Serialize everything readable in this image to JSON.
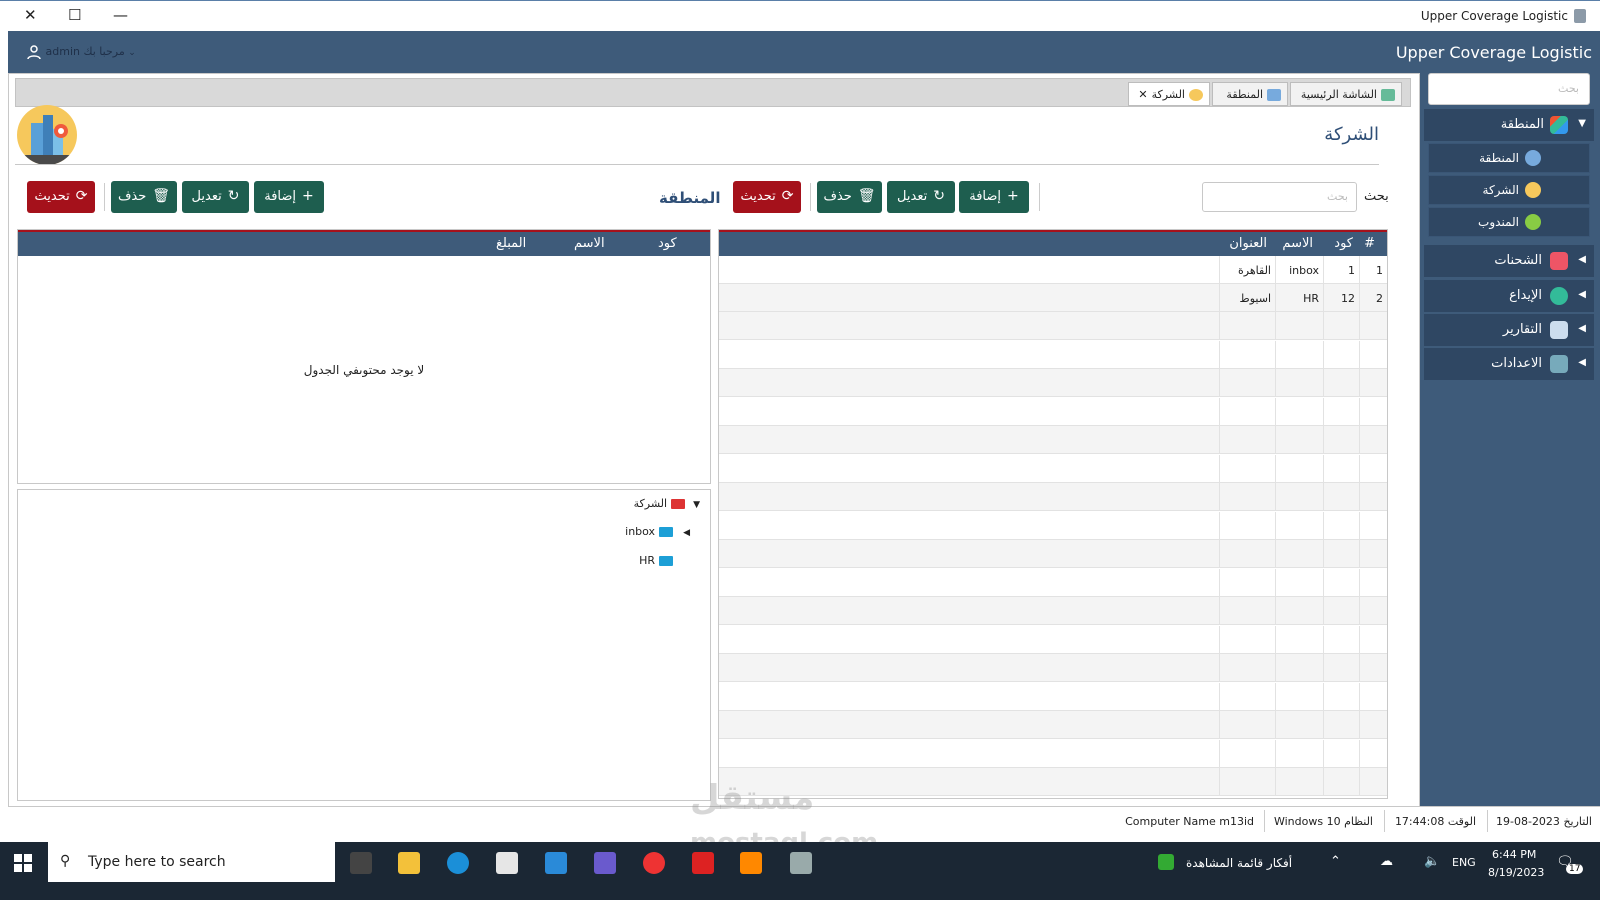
{
  "window": {
    "title": "Upper Coverage Logistic"
  },
  "header": {
    "brand": "Upper Coverage Logistic",
    "greeting": "مرحبا بك admin"
  },
  "sidebar": {
    "search_placeholder": "بحث",
    "groups": [
      {
        "label": "المنطقة",
        "expanded": true,
        "sub": [
          {
            "label": "المنطقة"
          },
          {
            "label": "الشركة"
          },
          {
            "label": "المندوب"
          }
        ]
      },
      {
        "label": "الشحنات"
      },
      {
        "label": "الإيداع"
      },
      {
        "label": "التقارير"
      },
      {
        "label": "الاعدادات"
      }
    ]
  },
  "tabs": [
    {
      "label": "الشاشة الرئيسية"
    },
    {
      "label": "المنطقة"
    },
    {
      "label": "الشركة",
      "closable": true
    }
  ],
  "page": {
    "title": "الشركة"
  },
  "left_panel": {
    "title": "المنطقة",
    "buttons": {
      "add": "إضافة",
      "edit": "تعديل",
      "delete": "حذف",
      "refresh": "تحديث"
    },
    "columns": [
      "كود",
      "الاسم",
      "المبلغ"
    ],
    "empty_message": "لا يوجد محتوىفي الجدول"
  },
  "tree": {
    "root": "الشركة",
    "children": [
      "inbox",
      "HR"
    ]
  },
  "right_panel": {
    "search_label": "بحث",
    "search_placeholder": "بحث",
    "buttons": {
      "add": "إضافة",
      "edit": "تعديل",
      "delete": "حذف",
      "refresh": "تحديث"
    },
    "columns": [
      "#",
      "كود",
      "الاسم",
      "العنوان"
    ],
    "rows": [
      {
        "num": "1",
        "code": "1",
        "name": "inbox",
        "address": "القاهرة"
      },
      {
        "num": "2",
        "code": "12",
        "name": "HR",
        "address": "اسيوط"
      }
    ]
  },
  "status": {
    "date_label": "التاريخ",
    "date": "2023-08-19",
    "time_label": "الوقت",
    "time": "17:44:08",
    "os_label": "النظام",
    "os": "Windows 10",
    "computer_label": "Computer Name",
    "computer": "m13id"
  },
  "taskbar": {
    "search_placeholder": "Type here to search",
    "news": "أفكار قائمة المشاهدة",
    "lang": "ENG",
    "time": "6:44 PM",
    "date": "8/19/2023",
    "notif_count": "17"
  },
  "watermark": {
    "line1": "مستقل",
    "line2": "mostaql.com"
  },
  "colors": {
    "header": "#3e5b7a",
    "sidebar_item": "#2f4763",
    "green_button": "#1e5e4f",
    "red_button": "#a5111b",
    "title": "#2f4f77"
  }
}
